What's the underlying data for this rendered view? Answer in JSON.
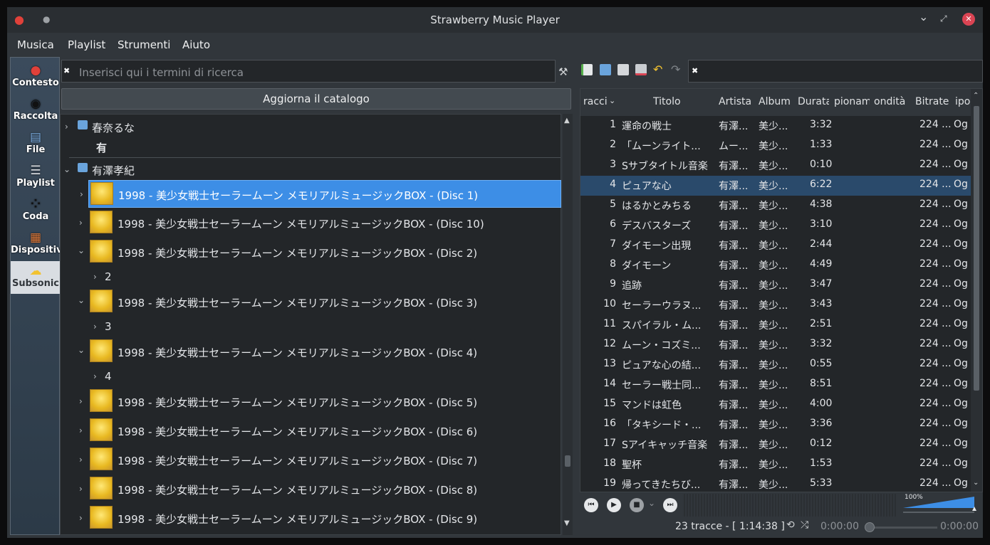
{
  "window": {
    "title": "Strawberry Music Player"
  },
  "menu": [
    "Musica",
    "Playlist",
    "Strumenti",
    "Aiuto"
  ],
  "sidebar": [
    {
      "label": "Contesto",
      "icon": "strawberry-icon"
    },
    {
      "label": "Raccolta",
      "icon": "vinyl-disc-icon"
    },
    {
      "label": "File",
      "icon": "file-folder-icon"
    },
    {
      "label": "Playlist",
      "icon": "playlist-icon"
    },
    {
      "label": "Coda",
      "icon": "footsteps-icon"
    },
    {
      "label": "Dispositivi",
      "icon": "devices-icon"
    },
    {
      "label": "Subsonic",
      "icon": "subsonic-icon"
    }
  ],
  "library": {
    "search_placeholder": "Inserisci qui i termini di ricerca",
    "update_button": "Aggiorna il catalogo",
    "tree": [
      {
        "type": "artist",
        "label": "春奈るな",
        "expanded": false
      },
      {
        "type": "divider",
        "label": "有"
      },
      {
        "type": "artist",
        "label": "有澤孝紀",
        "expanded": true
      },
      {
        "type": "album",
        "label": "1998 - 美少女戦士セーラームーン メモリアルミュージックBOX - (Disc 1)",
        "selected": true,
        "expanded": false
      },
      {
        "type": "album",
        "label": "1998 - 美少女戦士セーラームーン メモリアルミュージックBOX - (Disc 10)",
        "expanded": false
      },
      {
        "type": "album",
        "label": "1998 - 美少女戦士セーラームーン メモリアルミュージックBOX - (Disc 2)",
        "expanded": true
      },
      {
        "type": "disc",
        "label": "2"
      },
      {
        "type": "album",
        "label": "1998 - 美少女戦士セーラームーン メモリアルミュージックBOX - (Disc 3)",
        "expanded": true
      },
      {
        "type": "disc",
        "label": "3"
      },
      {
        "type": "album",
        "label": "1998 - 美少女戦士セーラームーン メモリアルミュージックBOX - (Disc 4)",
        "expanded": true
      },
      {
        "type": "disc",
        "label": "4"
      },
      {
        "type": "album",
        "label": "1998 - 美少女戦士セーラームーン メモリアルミュージックBOX - (Disc 5)",
        "expanded": false
      },
      {
        "type": "album",
        "label": "1998 - 美少女戦士セーラームーン メモリアルミュージックBOX - (Disc 6)",
        "expanded": false
      },
      {
        "type": "album",
        "label": "1998 - 美少女戦士セーラームーン メモリアルミュージックBOX - (Disc 7)",
        "expanded": false
      },
      {
        "type": "album",
        "label": "1998 - 美少女戦士セーラームーン メモリアルミュージックBOX - (Disc 8)",
        "expanded": false
      },
      {
        "type": "album",
        "label": "1998 - 美少女戦士セーラームーン メモリアルミュージックBOX - (Disc 9)",
        "expanded": false
      }
    ]
  },
  "playlist": {
    "columns": [
      "racci",
      "Titolo",
      "Artista",
      "Album",
      "Durata",
      "pionam",
      "ondità",
      "Bitrate",
      "ipo"
    ],
    "current_row": 4,
    "rows": [
      {
        "n": "1",
        "title": "運命の戦士",
        "artist": "有澤...",
        "album": "美少...",
        "duration": "3:32",
        "bitrate": "224 ...",
        "type": "Og"
      },
      {
        "n": "2",
        "title": "「ムーンライト...",
        "artist": "ムー...",
        "album": "美少...",
        "duration": "1:33",
        "bitrate": "224 ...",
        "type": "Og"
      },
      {
        "n": "3",
        "title": "Sサブタイトル音楽",
        "artist": "有澤...",
        "album": "美少...",
        "duration": "0:10",
        "bitrate": "224 ...",
        "type": "Og"
      },
      {
        "n": "4",
        "title": "ピュアな心",
        "artist": "有澤...",
        "album": "美少...",
        "duration": "6:22",
        "bitrate": "224 ...",
        "type": "Og"
      },
      {
        "n": "5",
        "title": "はるかとみちる",
        "artist": "有澤...",
        "album": "美少...",
        "duration": "4:38",
        "bitrate": "224 ...",
        "type": "Og"
      },
      {
        "n": "6",
        "title": "デスバスターズ",
        "artist": "有澤...",
        "album": "美少...",
        "duration": "3:10",
        "bitrate": "224 ...",
        "type": "Og"
      },
      {
        "n": "7",
        "title": "ダイモーン出現",
        "artist": "有澤...",
        "album": "美少...",
        "duration": "2:44",
        "bitrate": "224 ...",
        "type": "Og"
      },
      {
        "n": "8",
        "title": "ダイモーン",
        "artist": "有澤...",
        "album": "美少...",
        "duration": "4:49",
        "bitrate": "224 ...",
        "type": "Og"
      },
      {
        "n": "9",
        "title": "追跡",
        "artist": "有澤...",
        "album": "美少...",
        "duration": "3:47",
        "bitrate": "224 ...",
        "type": "Og"
      },
      {
        "n": "10",
        "title": "セーラーウラヌ...",
        "artist": "有澤...",
        "album": "美少...",
        "duration": "3:43",
        "bitrate": "224 ...",
        "type": "Og"
      },
      {
        "n": "11",
        "title": "スパイラル・ム...",
        "artist": "有澤...",
        "album": "美少...",
        "duration": "2:51",
        "bitrate": "224 ...",
        "type": "Og"
      },
      {
        "n": "12",
        "title": "ムーン・コズミ...",
        "artist": "有澤...",
        "album": "美少...",
        "duration": "3:32",
        "bitrate": "224 ...",
        "type": "Og"
      },
      {
        "n": "13",
        "title": "ピュアな心の結...",
        "artist": "有澤...",
        "album": "美少...",
        "duration": "0:55",
        "bitrate": "224 ...",
        "type": "Og"
      },
      {
        "n": "14",
        "title": "セーラー戦士同...",
        "artist": "有澤...",
        "album": "美少...",
        "duration": "8:51",
        "bitrate": "224 ...",
        "type": "Og"
      },
      {
        "n": "15",
        "title": "マンドは虹色",
        "artist": "有澤...",
        "album": "美少...",
        "duration": "4:00",
        "bitrate": "224 ...",
        "type": "Og"
      },
      {
        "n": "16",
        "title": "「タキシード・...",
        "artist": "有澤...",
        "album": "美少...",
        "duration": "3:36",
        "bitrate": "224 ...",
        "type": "Og"
      },
      {
        "n": "17",
        "title": "Sアイキャッチ音楽",
        "artist": "有澤...",
        "album": "美少...",
        "duration": "0:12",
        "bitrate": "224 ...",
        "type": "Og"
      },
      {
        "n": "18",
        "title": "聖杯",
        "artist": "有澤...",
        "album": "美少...",
        "duration": "1:53",
        "bitrate": "224 ...",
        "type": "Og"
      },
      {
        "n": "19",
        "title": "帰ってきたちび...",
        "artist": "有澤...",
        "album": "美少...",
        "duration": "5:33",
        "bitrate": "224 ...",
        "type": "Og"
      }
    ]
  },
  "player": {
    "volume": "100%",
    "volume_level": 1.0,
    "summary": "23 tracce - [ 1:14:38 ]",
    "elapsed": "0:00:00",
    "total": "0:00:00",
    "seek_position": 0
  },
  "colors": {
    "accent": "#3d8ee6",
    "current_row": "#2a4a6b",
    "close_button": "#da4453"
  }
}
